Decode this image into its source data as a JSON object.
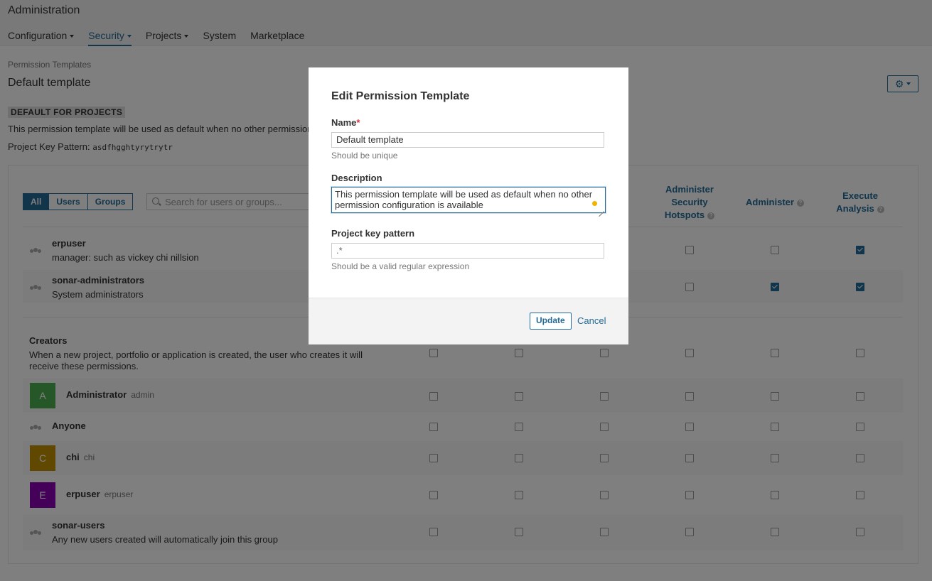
{
  "header": {
    "title": "Administration",
    "nav": [
      {
        "label": "Configuration",
        "dropdown": true,
        "active": false
      },
      {
        "label": "Security",
        "dropdown": true,
        "active": true
      },
      {
        "label": "Projects",
        "dropdown": true,
        "active": false
      },
      {
        "label": "System",
        "dropdown": false,
        "active": false
      },
      {
        "label": "Marketplace",
        "dropdown": false,
        "active": false
      }
    ]
  },
  "breadcrumb": "Permission Templates",
  "template": {
    "title": "Default template",
    "badge": "DEFAULT FOR PROJECTS",
    "description_visible": "This permission template will be used as default when no other permission",
    "key_pattern_label": "Project Key Pattern:",
    "key_pattern_value": "asdfhgghtyrytrytr"
  },
  "filter": {
    "buttons": [
      "All",
      "Users",
      "Groups"
    ],
    "active": "All",
    "search_placeholder": "Search for users or groups..."
  },
  "columns": {
    "security_hotspots": [
      "Administer",
      "Security",
      "Hotspots"
    ],
    "administer": "Administer",
    "execute_analysis": [
      "Execute",
      "Analysis"
    ]
  },
  "groups": [
    {
      "name": "erpuser",
      "description": "manager: such as vickey chi nillsion",
      "hotspots": false,
      "administer": false,
      "execute": true
    },
    {
      "name": "sonar-administrators",
      "description": "System administrators",
      "hotspots": false,
      "administer": true,
      "execute": true
    }
  ],
  "creators": {
    "title": "Creators",
    "description": "When a new project, portfolio or application is created, the user who creates it will receive these permissions."
  },
  "members": [
    {
      "name": "Administrator",
      "login": "admin",
      "avatar_letter": "A",
      "avatar_color": "#4caf50",
      "type": "user"
    },
    {
      "name": "Anyone",
      "login": "",
      "type": "group"
    },
    {
      "name": "chi",
      "login": "chi",
      "avatar_letter": "C",
      "avatar_color": "#c09000",
      "type": "user"
    },
    {
      "name": "erpuser",
      "login": "erpuser",
      "avatar_letter": "E",
      "avatar_color": "#8b00b4",
      "type": "user"
    },
    {
      "name": "sonar-users",
      "login": "",
      "description": "Any new users created will automatically join this group",
      "type": "group"
    }
  ],
  "modal": {
    "title": "Edit Permission Template",
    "name_label": "Name",
    "required_mark": "*",
    "name_value": "Default template",
    "name_help": "Should be unique",
    "description_label": "Description",
    "description_line1": "This permission template will be used as default when no other",
    "description_line2": "permission configuration is available",
    "pattern_label": "Project key pattern",
    "pattern_value": ".*",
    "pattern_help": "Should be a valid regular expression",
    "update_label": "Update",
    "cancel_label": "Cancel"
  },
  "colors": {
    "accent": "#236a97",
    "overlay": "rgba(0,0,0,0.5)",
    "required": "#d4333f"
  }
}
